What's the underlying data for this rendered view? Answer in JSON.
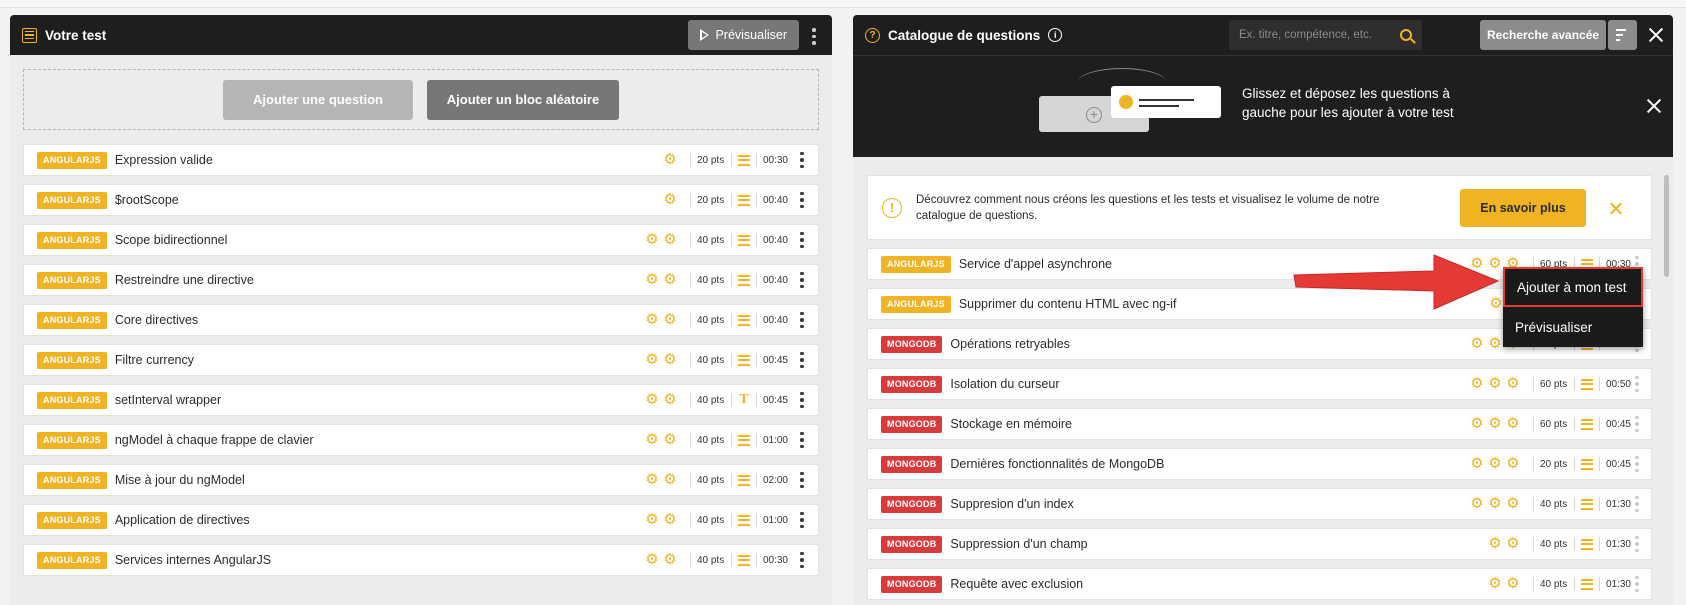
{
  "left_panel": {
    "title": "Votre test",
    "preview_label": "Prévisualiser",
    "add_question_label": "Ajouter une question",
    "add_random_block_label": "Ajouter un bloc aléatoire",
    "questions": [
      {
        "tag": "ANGULARJS",
        "title": "Expression valide",
        "gears": 1,
        "points": "20 pts",
        "type": "list",
        "time": "00:30"
      },
      {
        "tag": "ANGULARJS",
        "title": "$rootScope",
        "gears": 1,
        "points": "20 pts",
        "type": "list",
        "time": "00:40"
      },
      {
        "tag": "ANGULARJS",
        "title": "Scope bidirectionnel",
        "gears": 2,
        "points": "40 pts",
        "type": "list",
        "time": "00:40"
      },
      {
        "tag": "ANGULARJS",
        "title": "Restreindre une directive",
        "gears": 2,
        "points": "40 pts",
        "type": "list",
        "time": "00:40"
      },
      {
        "tag": "ANGULARJS",
        "title": "Core directives",
        "gears": 2,
        "points": "40 pts",
        "type": "list",
        "time": "00:40"
      },
      {
        "tag": "ANGULARJS",
        "title": "Filtre currency",
        "gears": 2,
        "points": "40 pts",
        "type": "list",
        "time": "00:45"
      },
      {
        "tag": "ANGULARJS",
        "title": "setInterval wrapper",
        "gears": 2,
        "points": "40 pts",
        "type": "text",
        "time": "00:45"
      },
      {
        "tag": "ANGULARJS",
        "title": "ngModel à chaque frappe de clavier",
        "gears": 2,
        "points": "40 pts",
        "type": "list",
        "time": "01:00"
      },
      {
        "tag": "ANGULARJS",
        "title": "Mise à jour du ngModel",
        "gears": 2,
        "points": "40 pts",
        "type": "list",
        "time": "02:00"
      },
      {
        "tag": "ANGULARJS",
        "title": "Application de directives",
        "gears": 2,
        "points": "40 pts",
        "type": "list",
        "time": "01:00"
      },
      {
        "tag": "ANGULARJS",
        "title": "Services internes AngularJS",
        "gears": 2,
        "points": "40 pts",
        "type": "list",
        "time": "00:30"
      }
    ]
  },
  "right_panel": {
    "title": "Catalogue de questions",
    "search_placeholder": "Ex. titre, compétence, etc.",
    "advanced_search_label": "Recherche avancée",
    "banner_text": "Glissez et déposez les questions à gauche pour les ajouter à votre test",
    "notice_text": "Découvrez comment nous créons les questions et les tests et visualisez le volume de notre catalogue de questions.",
    "learn_more_label": "En savoir plus",
    "questions": [
      {
        "tag": "ANGULARJS",
        "title": "Service d'appel asynchrone",
        "gears": 3,
        "points": "60 pts",
        "type": "list",
        "time": "00:30"
      },
      {
        "tag": "ANGULARJS",
        "title": "Supprimer du contenu HTML avec ng-if",
        "gears": 2,
        "points": "",
        "type": "list",
        "time": ""
      },
      {
        "tag": "MONGODB",
        "title": "Opérations retryables",
        "gears": 3,
        "points": "60 pts",
        "type": "list",
        "time": "01:00"
      },
      {
        "tag": "MONGODB",
        "title": "Isolation du curseur",
        "gears": 3,
        "points": "60 pts",
        "type": "list",
        "time": "00:50"
      },
      {
        "tag": "MONGODB",
        "title": "Stockage en mémoire",
        "gears": 3,
        "points": "60 pts",
        "type": "list",
        "time": "00:45"
      },
      {
        "tag": "MONGODB",
        "title": "Dernières fonctionnalités de MongoDB",
        "gears": 3,
        "points": "20 pts",
        "type": "list",
        "time": "00:45"
      },
      {
        "tag": "MONGODB",
        "title": "Suppresion d'un index",
        "gears": 3,
        "points": "40 pts",
        "type": "list",
        "time": "01:30"
      },
      {
        "tag": "MONGODB",
        "title": "Suppression d'un champ",
        "gears": 2,
        "points": "40 pts",
        "type": "list",
        "time": "01:30"
      },
      {
        "tag": "MONGODB",
        "title": "Requête avec exclusion",
        "gears": 2,
        "points": "40 pts",
        "type": "list",
        "time": "01:30"
      }
    ]
  },
  "context_menu": {
    "add_label": "Ajouter à mon test",
    "preview_label": "Prévisualiser"
  },
  "colors": {
    "accent": "#f0b323",
    "mongo_tag": "#d93a3a",
    "dark_header": "#1e1e1e",
    "highlight": "#e53935"
  }
}
